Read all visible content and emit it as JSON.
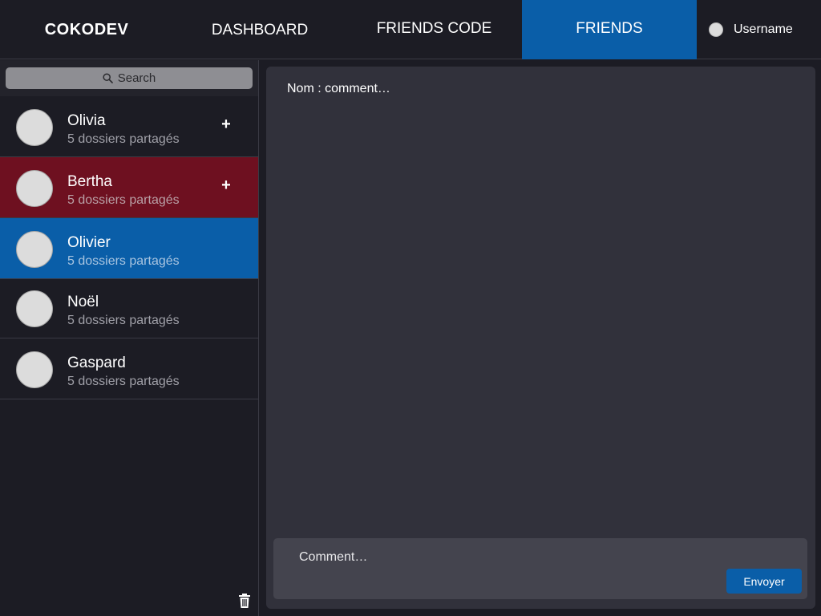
{
  "header": {
    "brand": "COKODEV",
    "tabs": [
      {
        "label": "DASHBOARD",
        "active": false
      },
      {
        "label": "FRIENDS CODE",
        "active": false
      },
      {
        "label": "FRIENDS",
        "active": true
      }
    ],
    "username": "Username"
  },
  "sidebar": {
    "search": {
      "label": "Search",
      "icon": "search-icon"
    },
    "friends": [
      {
        "name": "Olivia",
        "subtitle": "5 dossiers partagés",
        "state": "normal",
        "has_add": true
      },
      {
        "name": "Bertha",
        "subtitle": "5 dossiers partagés",
        "state": "highlighted-red",
        "has_add": true
      },
      {
        "name": "Olivier",
        "subtitle": "5 dossiers partagés",
        "state": "selected",
        "has_add": false
      },
      {
        "name": "Noël",
        "subtitle": "5 dossiers partagés",
        "state": "normal",
        "has_add": false
      },
      {
        "name": "Gaspard",
        "subtitle": "5 dossiers partagés",
        "state": "normal",
        "has_add": false
      }
    ],
    "add_symbol": "+",
    "delete_icon": "trash-icon"
  },
  "main": {
    "comment_text": "Nom : comment…",
    "composer": {
      "placeholder": "Comment…",
      "send_label": "Envoyer"
    }
  },
  "colors": {
    "background": "#1c1c24",
    "panel": "#31313b",
    "accent_blue": "#0a5ea8",
    "accent_red": "#6e1020",
    "search_bg": "#8e8e93"
  }
}
